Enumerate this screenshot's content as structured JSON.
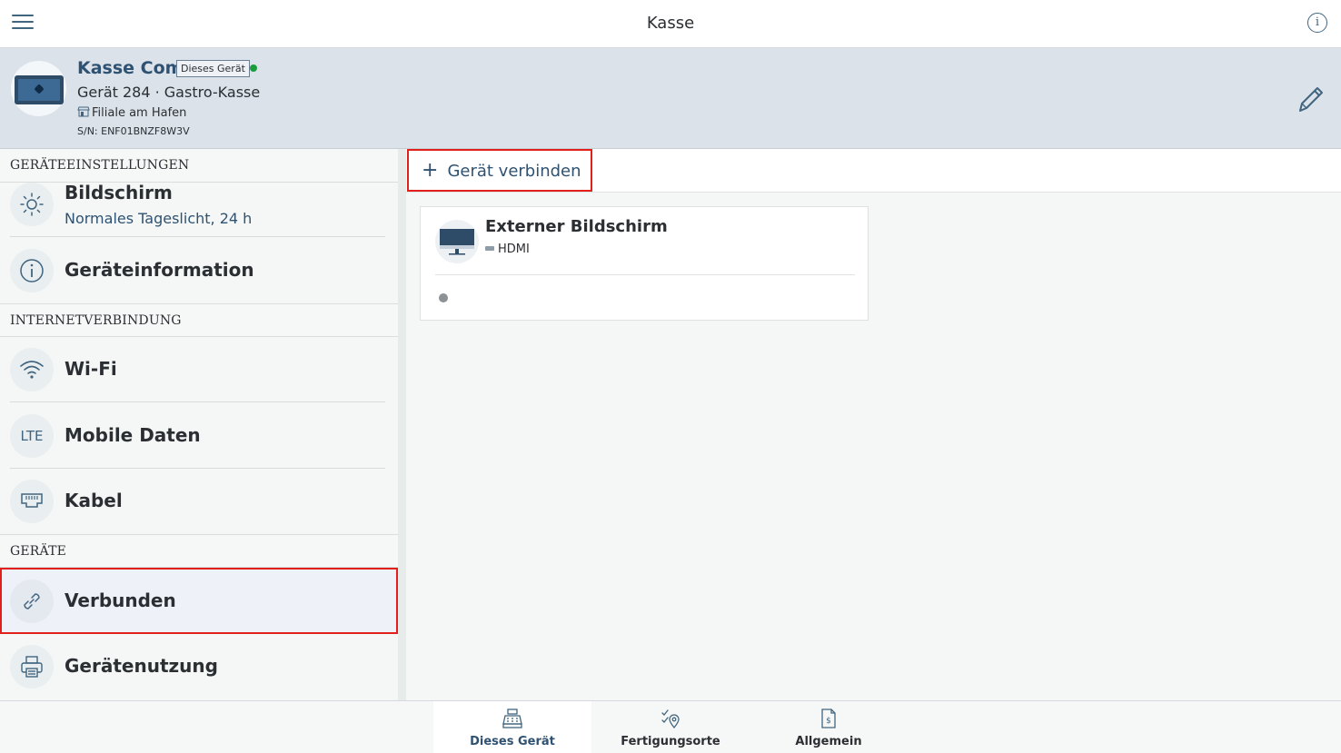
{
  "topbar": {
    "title": "Kasse",
    "menu_icon": "hamburger-icon",
    "info_icon": "info-icon"
  },
  "device": {
    "name": "Kasse Comet",
    "badge": "Dieses Gerät",
    "status_color": "#1a9d3c",
    "model": "Gerät 284 · Gastro-Kasse",
    "branch": "Filiale am Hafen",
    "serial": "S/N: ENF01BNZF8W3V",
    "edit_icon": "pencil-icon"
  },
  "sidebar": {
    "sections": [
      {
        "title": "GERÄTEEINSTELLUNGEN"
      },
      {
        "title": "INTERNETVERBINDUNG"
      },
      {
        "title": "GERÄTE"
      }
    ],
    "items": [
      {
        "label": "Bildschirm",
        "sub": "Normales Tageslicht, 24 h",
        "icon": "brightness-icon"
      },
      {
        "label": "Geräteinformation",
        "icon": "info-circle-icon"
      },
      {
        "label": "Wi-Fi",
        "icon": "wifi-icon"
      },
      {
        "label": "Mobile Daten",
        "icon": "lte-icon",
        "icon_text": "LTE"
      },
      {
        "label": "Kabel",
        "icon": "ethernet-icon"
      },
      {
        "label": "Verbunden",
        "icon": "link-icon",
        "selected": true
      },
      {
        "label": "Gerätenutzung",
        "icon": "printer-icon"
      }
    ]
  },
  "main": {
    "connect_label": "Gerät verbinden",
    "connect_icon": "plus-icon",
    "devices": [
      {
        "name": "Externer Bildschirm",
        "connection": "HDMI",
        "icon": "monitor-icon",
        "status_color": "#8e9194"
      }
    ]
  },
  "bottom_tabs": [
    {
      "label": "Dieses Gerät",
      "icon": "cash-register-icon",
      "active": true
    },
    {
      "label": "Fertigungsorte",
      "icon": "route-location-icon",
      "active": false
    },
    {
      "label": "Allgemein",
      "icon": "document-dollar-icon",
      "active": false
    }
  ],
  "colors": {
    "accent": "#2f5272",
    "highlight_border": "#e2201b",
    "header_bg": "#dbe2ea"
  }
}
